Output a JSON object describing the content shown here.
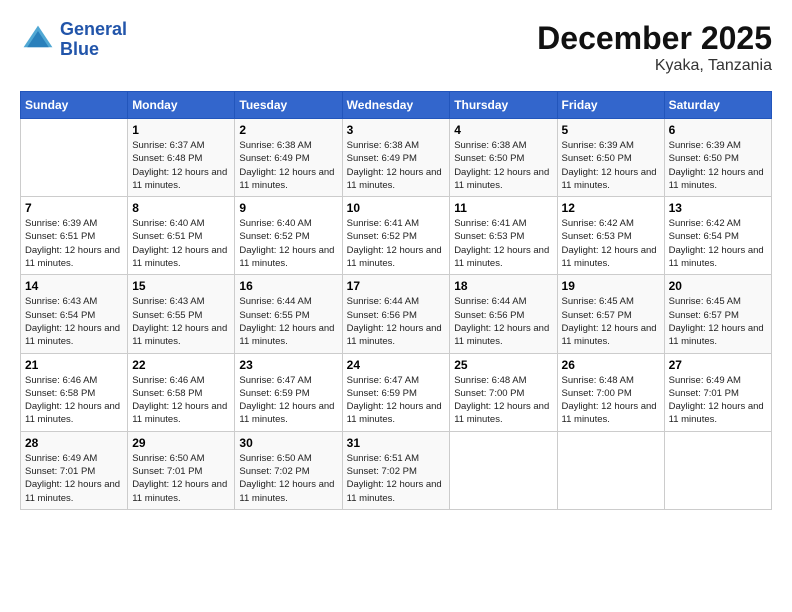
{
  "header": {
    "logo_line1": "General",
    "logo_line2": "Blue",
    "month_year": "December 2025",
    "location": "Kyaka, Tanzania"
  },
  "weekdays": [
    "Sunday",
    "Monday",
    "Tuesday",
    "Wednesday",
    "Thursday",
    "Friday",
    "Saturday"
  ],
  "weeks": [
    [
      {
        "day": "",
        "sunrise": "",
        "sunset": "",
        "daylight": ""
      },
      {
        "day": "1",
        "sunrise": "Sunrise: 6:37 AM",
        "sunset": "Sunset: 6:48 PM",
        "daylight": "Daylight: 12 hours and 11 minutes."
      },
      {
        "day": "2",
        "sunrise": "Sunrise: 6:38 AM",
        "sunset": "Sunset: 6:49 PM",
        "daylight": "Daylight: 12 hours and 11 minutes."
      },
      {
        "day": "3",
        "sunrise": "Sunrise: 6:38 AM",
        "sunset": "Sunset: 6:49 PM",
        "daylight": "Daylight: 12 hours and 11 minutes."
      },
      {
        "day": "4",
        "sunrise": "Sunrise: 6:38 AM",
        "sunset": "Sunset: 6:50 PM",
        "daylight": "Daylight: 12 hours and 11 minutes."
      },
      {
        "day": "5",
        "sunrise": "Sunrise: 6:39 AM",
        "sunset": "Sunset: 6:50 PM",
        "daylight": "Daylight: 12 hours and 11 minutes."
      },
      {
        "day": "6",
        "sunrise": "Sunrise: 6:39 AM",
        "sunset": "Sunset: 6:50 PM",
        "daylight": "Daylight: 12 hours and 11 minutes."
      }
    ],
    [
      {
        "day": "7",
        "sunrise": "Sunrise: 6:39 AM",
        "sunset": "Sunset: 6:51 PM",
        "daylight": "Daylight: 12 hours and 11 minutes."
      },
      {
        "day": "8",
        "sunrise": "Sunrise: 6:40 AM",
        "sunset": "Sunset: 6:51 PM",
        "daylight": "Daylight: 12 hours and 11 minutes."
      },
      {
        "day": "9",
        "sunrise": "Sunrise: 6:40 AM",
        "sunset": "Sunset: 6:52 PM",
        "daylight": "Daylight: 12 hours and 11 minutes."
      },
      {
        "day": "10",
        "sunrise": "Sunrise: 6:41 AM",
        "sunset": "Sunset: 6:52 PM",
        "daylight": "Daylight: 12 hours and 11 minutes."
      },
      {
        "day": "11",
        "sunrise": "Sunrise: 6:41 AM",
        "sunset": "Sunset: 6:53 PM",
        "daylight": "Daylight: 12 hours and 11 minutes."
      },
      {
        "day": "12",
        "sunrise": "Sunrise: 6:42 AM",
        "sunset": "Sunset: 6:53 PM",
        "daylight": "Daylight: 12 hours and 11 minutes."
      },
      {
        "day": "13",
        "sunrise": "Sunrise: 6:42 AM",
        "sunset": "Sunset: 6:54 PM",
        "daylight": "Daylight: 12 hours and 11 minutes."
      }
    ],
    [
      {
        "day": "14",
        "sunrise": "Sunrise: 6:43 AM",
        "sunset": "Sunset: 6:54 PM",
        "daylight": "Daylight: 12 hours and 11 minutes."
      },
      {
        "day": "15",
        "sunrise": "Sunrise: 6:43 AM",
        "sunset": "Sunset: 6:55 PM",
        "daylight": "Daylight: 12 hours and 11 minutes."
      },
      {
        "day": "16",
        "sunrise": "Sunrise: 6:44 AM",
        "sunset": "Sunset: 6:55 PM",
        "daylight": "Daylight: 12 hours and 11 minutes."
      },
      {
        "day": "17",
        "sunrise": "Sunrise: 6:44 AM",
        "sunset": "Sunset: 6:56 PM",
        "daylight": "Daylight: 12 hours and 11 minutes."
      },
      {
        "day": "18",
        "sunrise": "Sunrise: 6:44 AM",
        "sunset": "Sunset: 6:56 PM",
        "daylight": "Daylight: 12 hours and 11 minutes."
      },
      {
        "day": "19",
        "sunrise": "Sunrise: 6:45 AM",
        "sunset": "Sunset: 6:57 PM",
        "daylight": "Daylight: 12 hours and 11 minutes."
      },
      {
        "day": "20",
        "sunrise": "Sunrise: 6:45 AM",
        "sunset": "Sunset: 6:57 PM",
        "daylight": "Daylight: 12 hours and 11 minutes."
      }
    ],
    [
      {
        "day": "21",
        "sunrise": "Sunrise: 6:46 AM",
        "sunset": "Sunset: 6:58 PM",
        "daylight": "Daylight: 12 hours and 11 minutes."
      },
      {
        "day": "22",
        "sunrise": "Sunrise: 6:46 AM",
        "sunset": "Sunset: 6:58 PM",
        "daylight": "Daylight: 12 hours and 11 minutes."
      },
      {
        "day": "23",
        "sunrise": "Sunrise: 6:47 AM",
        "sunset": "Sunset: 6:59 PM",
        "daylight": "Daylight: 12 hours and 11 minutes."
      },
      {
        "day": "24",
        "sunrise": "Sunrise: 6:47 AM",
        "sunset": "Sunset: 6:59 PM",
        "daylight": "Daylight: 12 hours and 11 minutes."
      },
      {
        "day": "25",
        "sunrise": "Sunrise: 6:48 AM",
        "sunset": "Sunset: 7:00 PM",
        "daylight": "Daylight: 12 hours and 11 minutes."
      },
      {
        "day": "26",
        "sunrise": "Sunrise: 6:48 AM",
        "sunset": "Sunset: 7:00 PM",
        "daylight": "Daylight: 12 hours and 11 minutes."
      },
      {
        "day": "27",
        "sunrise": "Sunrise: 6:49 AM",
        "sunset": "Sunset: 7:01 PM",
        "daylight": "Daylight: 12 hours and 11 minutes."
      }
    ],
    [
      {
        "day": "28",
        "sunrise": "Sunrise: 6:49 AM",
        "sunset": "Sunset: 7:01 PM",
        "daylight": "Daylight: 12 hours and 11 minutes."
      },
      {
        "day": "29",
        "sunrise": "Sunrise: 6:50 AM",
        "sunset": "Sunset: 7:01 PM",
        "daylight": "Daylight: 12 hours and 11 minutes."
      },
      {
        "day": "30",
        "sunrise": "Sunrise: 6:50 AM",
        "sunset": "Sunset: 7:02 PM",
        "daylight": "Daylight: 12 hours and 11 minutes."
      },
      {
        "day": "31",
        "sunrise": "Sunrise: 6:51 AM",
        "sunset": "Sunset: 7:02 PM",
        "daylight": "Daylight: 12 hours and 11 minutes."
      },
      {
        "day": "",
        "sunrise": "",
        "sunset": "",
        "daylight": ""
      },
      {
        "day": "",
        "sunrise": "",
        "sunset": "",
        "daylight": ""
      },
      {
        "day": "",
        "sunrise": "",
        "sunset": "",
        "daylight": ""
      }
    ]
  ]
}
